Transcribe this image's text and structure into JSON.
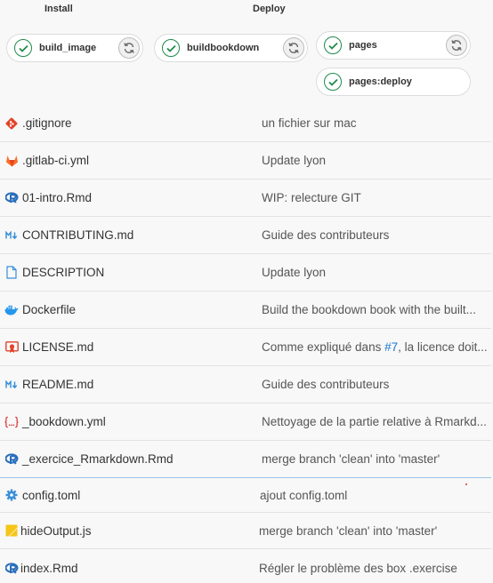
{
  "pipeline": {
    "stages": [
      {
        "title": "Install"
      },
      {
        "title": "Deploy"
      }
    ],
    "jobs": [
      {
        "name": "build_image",
        "status": "success",
        "retry": true
      },
      {
        "name": "buildbookdown",
        "status": "success",
        "retry": true
      },
      {
        "name": "pages",
        "status": "success",
        "retry": true
      },
      {
        "name": "pages:deploy",
        "status": "success",
        "retry": false
      }
    ],
    "colors": {
      "success": "#1f8a4c",
      "link": "#1f75cb"
    }
  },
  "files": [
    {
      "name": ".gitignore",
      "icon": "git-icon",
      "commit": "un fichier sur mac"
    },
    {
      "name": ".gitlab-ci.yml",
      "icon": "gitlab-icon",
      "commit": "Update lyon"
    },
    {
      "name": "01-intro.Rmd",
      "icon": "r-icon",
      "commit": "WIP: relecture GIT"
    },
    {
      "name": "CONTRIBUTING.md",
      "icon": "markdown-icon",
      "commit": "Guide des contributeurs"
    },
    {
      "name": "DESCRIPTION",
      "icon": "document-icon",
      "commit": "Update lyon"
    },
    {
      "name": "Dockerfile",
      "icon": "docker-icon",
      "commit": "Build the bookdown book with the built..."
    },
    {
      "name": "LICENSE.md",
      "icon": "license-icon",
      "commit_prefix": "Comme expliqué dans ",
      "commit_link": "#7",
      "commit_suffix": ", la licence doit..."
    },
    {
      "name": "README.md",
      "icon": "markdown-icon",
      "commit": "Guide des contributeurs"
    },
    {
      "name": "_bookdown.yml",
      "icon": "yaml-icon",
      "commit": "Nettoyage de la partie relative à Rmarkd..."
    },
    {
      "name": "_exercice_Rmarkdown.Rmd",
      "icon": "r-icon",
      "commit": "merge branch 'clean' into 'master'"
    },
    {
      "name": "config.toml",
      "icon": "gear-icon",
      "commit": "ajout config.toml"
    },
    {
      "name": "hideOutput.js",
      "icon": "javascript-icon",
      "commit": "merge branch 'clean' into 'master'"
    },
    {
      "name": "index.Rmd",
      "icon": "r-icon",
      "commit": "Régler le problème des box .exercise"
    }
  ]
}
